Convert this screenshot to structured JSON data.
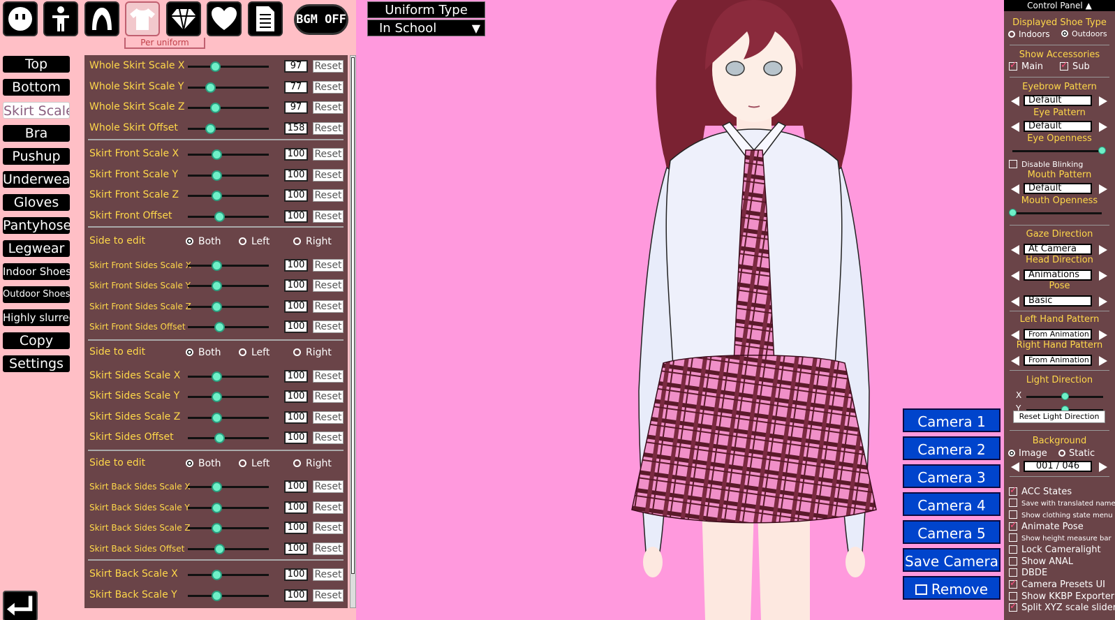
{
  "toolbar": {
    "icons": [
      "face-icon",
      "body-icon",
      "hair-icon",
      "clothes-icon",
      "accessory-icon",
      "heart-icon",
      "document-icon"
    ],
    "per_uniform": "Per uniform",
    "bgm": "BGM OFF"
  },
  "categories": [
    "Top",
    "Bottom",
    "Skirt Scale",
    "Bra",
    "Pushup",
    "Underwear",
    "Gloves",
    "Pantyhose",
    "Legwear",
    "Indoor Shoes",
    "Outdoor Shoes",
    "Highly slurred",
    "Copy",
    "Settings"
  ],
  "uniform": {
    "title": "Uniform Type",
    "value": "In School",
    "arrow": "▼"
  },
  "sliders": {
    "reset": "Reset",
    "side_label": "Side to edit",
    "side_options": [
      "Both",
      "Left",
      "Right"
    ],
    "rows": [
      {
        "label": "Whole Skirt Scale X",
        "value": "97",
        "pos": 0.34
      },
      {
        "label": "Whole Skirt Scale Y",
        "value": "77",
        "pos": 0.28
      },
      {
        "label": "Whole Skirt Scale Z",
        "value": "97",
        "pos": 0.34
      },
      {
        "label": "Whole Skirt Offset",
        "value": "158",
        "pos": 0.28
      },
      {
        "label": "Skirt Front Scale X",
        "value": "100",
        "pos": 0.35
      },
      {
        "label": "Skirt Front Scale Y",
        "value": "100",
        "pos": 0.35
      },
      {
        "label": "Skirt Front Scale Z",
        "value": "100",
        "pos": 0.35
      },
      {
        "label": "Skirt Front Offset",
        "value": "100",
        "pos": 0.39
      },
      {
        "label": "Skirt Front Sides Scale X",
        "value": "100",
        "pos": 0.35
      },
      {
        "label": "Skirt Front Sides Scale Y",
        "value": "100",
        "pos": 0.35
      },
      {
        "label": "Skirt Front Sides Scale Z",
        "value": "100",
        "pos": 0.35
      },
      {
        "label": "Skirt Front Sides Offset",
        "value": "100",
        "pos": 0.39
      },
      {
        "label": "Skirt Sides Scale X",
        "value": "100",
        "pos": 0.35
      },
      {
        "label": "Skirt Sides Scale Y",
        "value": "100",
        "pos": 0.35
      },
      {
        "label": "Skirt Sides Scale Z",
        "value": "100",
        "pos": 0.35
      },
      {
        "label": "Skirt Sides Offset",
        "value": "100",
        "pos": 0.39
      },
      {
        "label": "Skirt Back Sides Scale X",
        "value": "100",
        "pos": 0.35
      },
      {
        "label": "Skirt Back Sides Scale Y",
        "value": "100",
        "pos": 0.35
      },
      {
        "label": "Skirt Back Sides Scale Z",
        "value": "100",
        "pos": 0.35
      },
      {
        "label": "Skirt Back Sides Offset",
        "value": "100",
        "pos": 0.39
      },
      {
        "label": "Skirt Back Scale X",
        "value": "100",
        "pos": 0.35
      },
      {
        "label": "Skirt Back Scale Y",
        "value": "100",
        "pos": 0.35
      }
    ]
  },
  "cameras": [
    "Camera 1",
    "Camera 2",
    "Camera 3",
    "Camera 4",
    "Camera 5",
    "Save Camera",
    "Remove"
  ],
  "control_panel": {
    "title": "Control Panel",
    "title_arrow": "▲",
    "shoe_type": "Displayed Shoe Type",
    "indoors": "Indoors",
    "outdoors": "Outdoors",
    "show_accessories": "Show Accessories",
    "main": "Main",
    "sub": "Sub",
    "eyebrow_pattern": "Eyebrow Pattern",
    "eyebrow_value": "Default",
    "eye_pattern": "Eye Pattern",
    "eye_value": "Default",
    "eye_openness": "Eye Openness",
    "eye_openness_level": 1.0,
    "disable_blinking": "Disable Blinking",
    "mouth_pattern": "Mouth Pattern",
    "mouth_value": "Default",
    "mouth_openness": "Mouth Openness",
    "mouth_openness_level": 0.0,
    "gaze_direction": "Gaze Direction",
    "gaze_value": "At Camera",
    "head_direction": "Head Direction",
    "head_value": "Animations",
    "pose": "Pose",
    "pose_value": "Basic",
    "left_hand": "Left Hand Pattern",
    "left_hand_value": "From Animation",
    "right_hand": "Right Hand Pattern",
    "right_hand_value": "From Animation",
    "light_direction": "Light Direction",
    "light_x": "X",
    "light_y": "Y",
    "light_x_level": 0.5,
    "light_y_level": 0.5,
    "reset_light": "Reset Light Direction",
    "background": "Background",
    "bg_image": "Image",
    "bg_static": "Static",
    "bg_counter": "001 / 046",
    "options": [
      {
        "label": "ACC States",
        "checked": true,
        "small": false
      },
      {
        "label": "Save with translated names",
        "checked": false,
        "small": true
      },
      {
        "label": "Show clothing state menu",
        "checked": false,
        "small": true
      },
      {
        "label": "Animate Pose",
        "checked": true,
        "small": false
      },
      {
        "label": "Show height measure bar",
        "checked": false,
        "small": true
      },
      {
        "label": "Lock Cameralight",
        "checked": false,
        "small": false
      },
      {
        "label": "Show ANAL",
        "checked": false,
        "small": false
      },
      {
        "label": "DBDE",
        "checked": false,
        "small": false
      },
      {
        "label": "Camera Presets UI",
        "checked": true,
        "small": false
      },
      {
        "label": "Show KKBP Exporter",
        "checked": false,
        "small": false
      },
      {
        "label": "Split XYZ scale sliders",
        "checked": true,
        "small": false
      }
    ]
  },
  "colors": {
    "bg": "#ff99dd",
    "panel": "#6a4448",
    "label": "#ffd84a",
    "accent": "#6ff0c8",
    "camera": "#0044cc"
  }
}
